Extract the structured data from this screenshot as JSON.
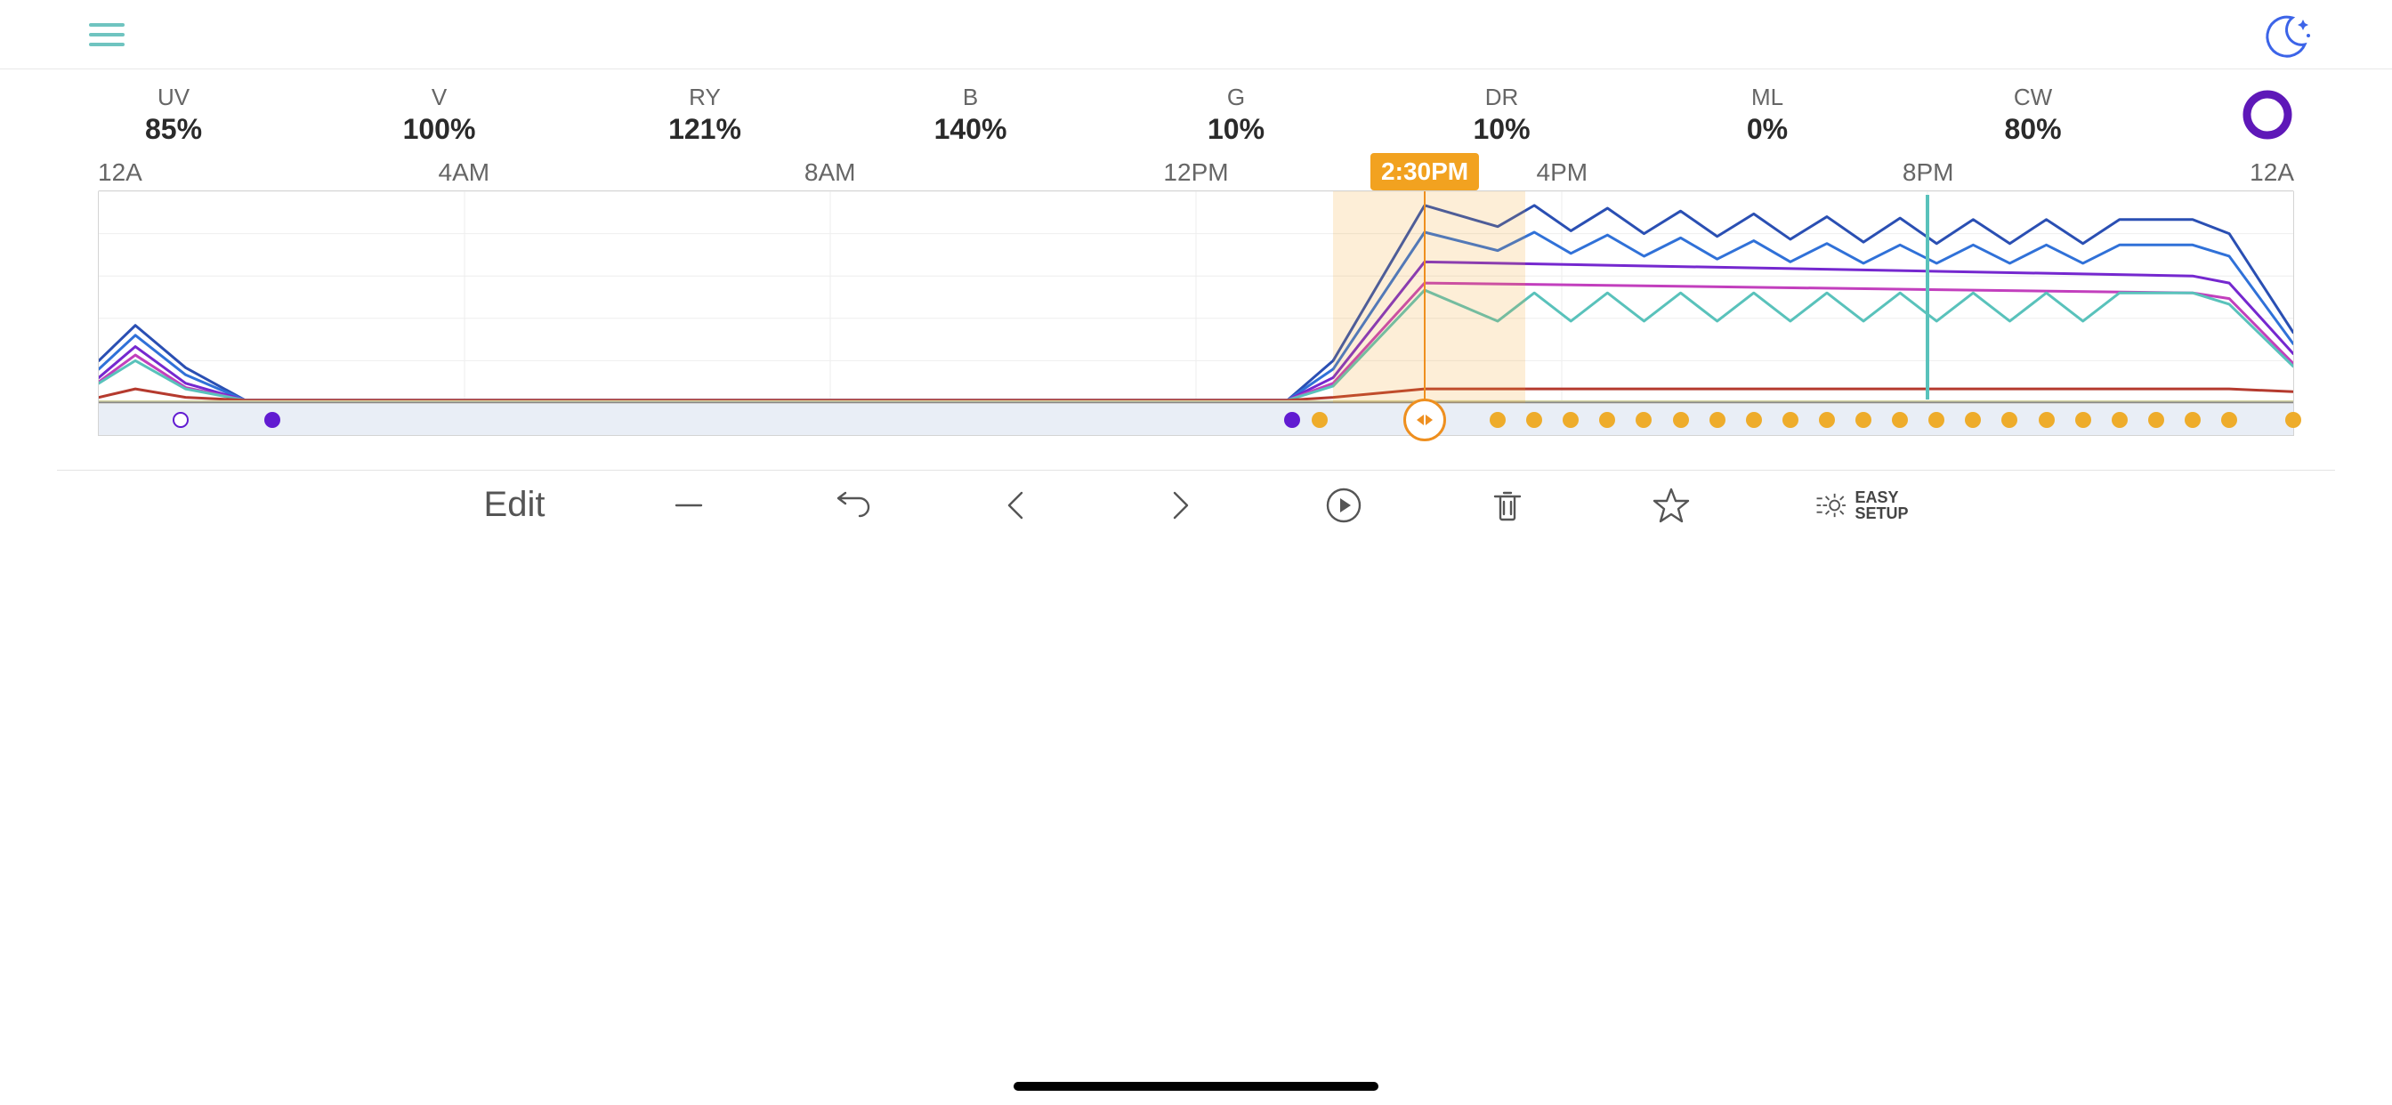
{
  "channels": [
    {
      "label": "UV",
      "value": "85%"
    },
    {
      "label": "V",
      "value": "100%"
    },
    {
      "label": "RY",
      "value": "121%"
    },
    {
      "label": "B",
      "value": "140%"
    },
    {
      "label": "G",
      "value": "10%"
    },
    {
      "label": "DR",
      "value": "10%"
    },
    {
      "label": "ML",
      "value": "0%"
    },
    {
      "label": "CW",
      "value": "80%"
    }
  ],
  "timeline": {
    "ticks": [
      {
        "label": "12A",
        "hour": 0
      },
      {
        "label": "4AM",
        "hour": 4
      },
      {
        "label": "8AM",
        "hour": 8
      },
      {
        "label": "12PM",
        "hour": 12
      },
      {
        "label": "4PM",
        "hour": 16
      },
      {
        "label": "8PM",
        "hour": 20
      },
      {
        "label": "12A",
        "hour": 24
      }
    ],
    "current_label": "2:30PM",
    "current_hour": 14.5,
    "band_start_hour": 13.5,
    "band_end_hour": 15.6,
    "moon_line_hour": 20.0
  },
  "point_markers": {
    "moon_marks": [
      0.9
    ],
    "purple_points": [
      1.9,
      13.05
    ],
    "orange_points": [
      13.35,
      15.3,
      15.7,
      16.1,
      16.5,
      16.9,
      17.3,
      17.7,
      18.1,
      18.5,
      18.9,
      19.3,
      19.7,
      20.1,
      20.5,
      20.9,
      21.3,
      21.7,
      22.1,
      22.5,
      22.9,
      23.3,
      24.0
    ]
  },
  "chart_data": {
    "type": "line",
    "xlabel": "",
    "ylabel": "",
    "xlim": [
      0,
      24
    ],
    "ylim": [
      0,
      150
    ],
    "x_ticks": [
      "12A",
      "4AM",
      "8AM",
      "12PM",
      "4PM",
      "8PM",
      "12A"
    ],
    "title": "",
    "series": [
      {
        "name": "B",
        "color": "#2a4fb3",
        "x": [
          0,
          0.4,
          0.95,
          1.6,
          13.0,
          13.5,
          14.5,
          15.3,
          15.7,
          16.1,
          16.5,
          16.9,
          17.3,
          17.7,
          18.1,
          18.5,
          18.9,
          19.3,
          19.7,
          20.1,
          20.5,
          20.9,
          21.3,
          21.7,
          22.1,
          22.5,
          22.9,
          23.3,
          24.0
        ],
        "y": [
          30,
          55,
          25,
          2,
          2,
          30,
          140,
          125,
          140,
          122,
          138,
          120,
          136,
          118,
          134,
          116,
          132,
          114,
          131,
          113,
          130,
          113,
          130,
          113,
          130,
          130,
          130,
          120,
          50
        ]
      },
      {
        "name": "RY",
        "color": "#3071d8",
        "x": [
          0,
          0.4,
          0.95,
          1.6,
          13.0,
          13.5,
          14.5,
          15.3,
          15.7,
          16.1,
          16.5,
          16.9,
          17.3,
          17.7,
          18.1,
          18.5,
          18.9,
          19.3,
          19.7,
          20.1,
          20.5,
          20.9,
          21.3,
          21.7,
          22.1,
          22.5,
          22.9,
          23.3,
          24.0
        ],
        "y": [
          24,
          48,
          20,
          2,
          2,
          24,
          121,
          108,
          121,
          106,
          119,
          104,
          117,
          102,
          115,
          100,
          113,
          99,
          112,
          99,
          112,
          99,
          112,
          99,
          112,
          112,
          112,
          104,
          42
        ]
      },
      {
        "name": "V",
        "color": "#7528cf",
        "x": [
          0,
          0.4,
          0.95,
          1.6,
          13.0,
          13.5,
          14.5,
          22.9,
          23.3,
          24.0
        ],
        "y": [
          18,
          40,
          14,
          2,
          2,
          18,
          100,
          90,
          85,
          35
        ]
      },
      {
        "name": "UV",
        "color": "#c23fbd",
        "x": [
          0,
          0.4,
          0.95,
          1.6,
          13.0,
          13.5,
          14.5,
          22.9,
          23.3,
          24.0
        ],
        "y": [
          15,
          34,
          11,
          2,
          2,
          14,
          85,
          78,
          74,
          28
        ]
      },
      {
        "name": "CW",
        "color": "#59c2bb",
        "x": [
          0,
          0.4,
          0.95,
          1.6,
          13.0,
          13.5,
          14.5,
          15.3,
          15.7,
          16.1,
          16.5,
          16.9,
          17.3,
          17.7,
          18.1,
          18.5,
          18.9,
          19.3,
          19.7,
          20.1,
          20.5,
          20.9,
          21.3,
          21.7,
          22.1,
          22.5,
          22.9,
          23.3,
          24.0
        ],
        "y": [
          14,
          30,
          10,
          2,
          2,
          12,
          80,
          58,
          78,
          58,
          78,
          58,
          78,
          58,
          78,
          58,
          78,
          58,
          78,
          58,
          78,
          58,
          78,
          58,
          78,
          78,
          78,
          70,
          26
        ]
      },
      {
        "name": "DR",
        "color": "#b53a2e",
        "x": [
          0,
          0.4,
          0.95,
          1.6,
          13.0,
          13.5,
          14.5,
          23.3,
          24.0
        ],
        "y": [
          4,
          10,
          4,
          2,
          2,
          4,
          10,
          10,
          8
        ]
      },
      {
        "name": "G",
        "color": "#d6d6a6",
        "x": [
          0,
          24
        ],
        "y": [
          1,
          1
        ]
      },
      {
        "name": "ML",
        "color": "#888888",
        "x": [
          0,
          24
        ],
        "y": [
          0,
          0
        ]
      }
    ]
  },
  "toolbar": {
    "edit": "Edit",
    "easy_line1": "EASY",
    "easy_line2": "SETUP"
  },
  "colors": {
    "accent_orange": "#ee8f1f",
    "accent_teal": "#59c2bb",
    "accent_purple": "#611bd1",
    "dot_orange": "#eeac2b"
  }
}
